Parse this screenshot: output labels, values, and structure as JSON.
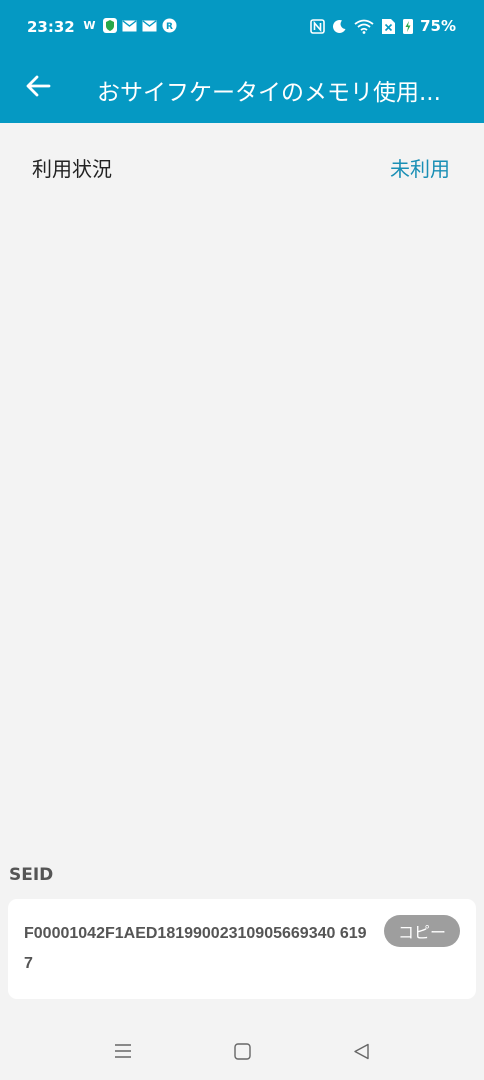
{
  "status_bar": {
    "time": "23:32",
    "battery": "75%",
    "left_icons": [
      "w-icon",
      "shield-icon",
      "mail-icon",
      "mail-icon",
      "rakuten-icon"
    ],
    "right_icons": [
      "nfc-icon",
      "moon-icon",
      "wifi-icon",
      "sim-x-icon",
      "battery-charging-icon"
    ]
  },
  "toolbar": {
    "title": "おサイフケータイのメモリ使用...",
    "background_color": "#0599c3"
  },
  "usage": {
    "label": "利用状況",
    "value": "未利用"
  },
  "seid": {
    "label": "SEID",
    "value": "F00001042F1AED18199002310905669340 6197",
    "copy_label": "コピー"
  },
  "navigation": {
    "icons": [
      "menu-icon",
      "home-icon",
      "back-triangle-icon"
    ]
  }
}
